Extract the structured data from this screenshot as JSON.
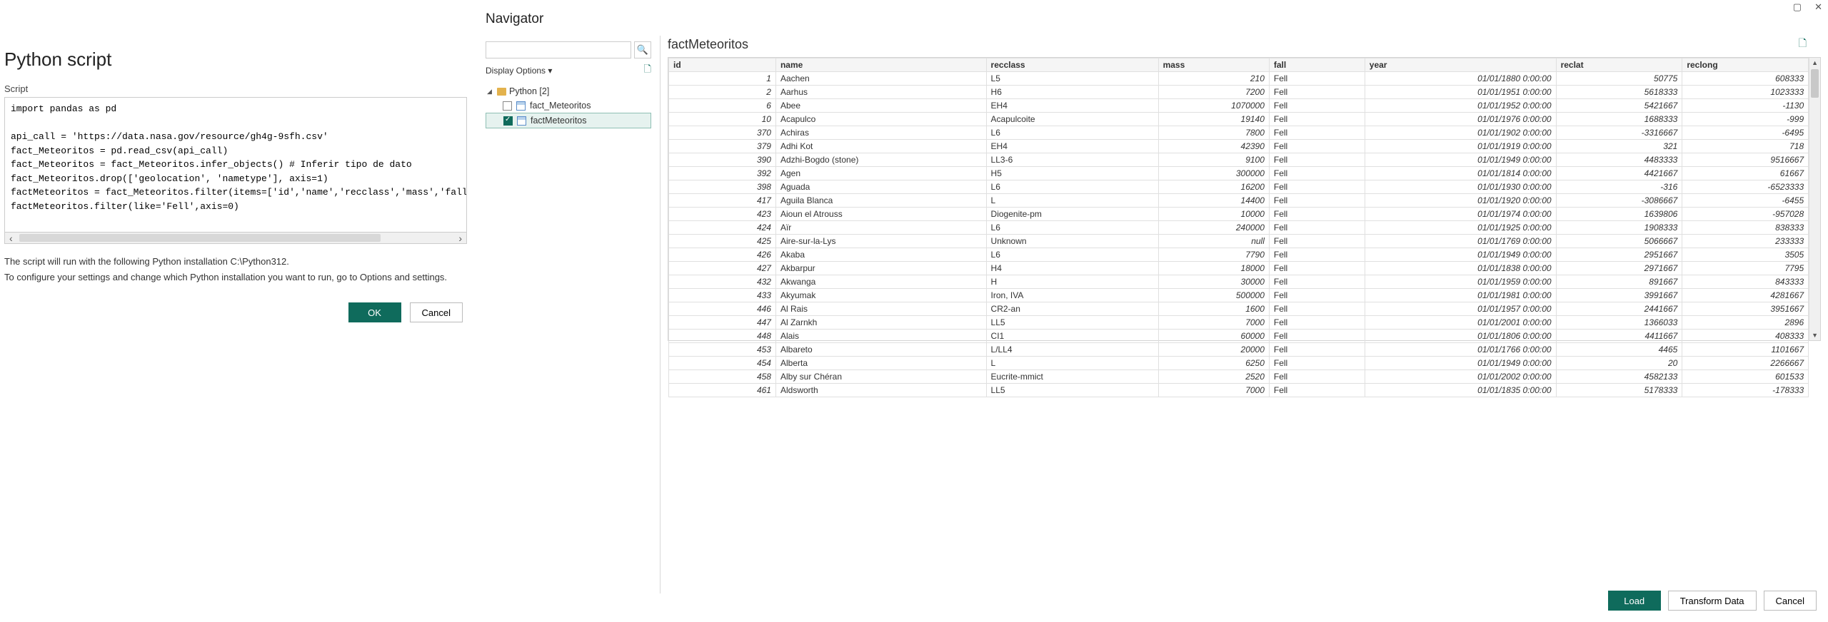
{
  "left": {
    "title": "Python script",
    "script_label": "Script",
    "script_text": "import pandas as pd\n\napi_call = 'https://data.nasa.gov/resource/gh4g-9sfh.csv'\nfact_Meteoritos = pd.read_csv(api_call)\nfact_Meteoritos = fact_Meteoritos.infer_objects() # Inferir tipo de dato\nfact_Meteoritos.drop(['geolocation', 'nametype'], axis=1)\nfactMeteoritos = fact_Meteoritos.filter(items=['id','name','recclass','mass','fall','year','recl\nfactMeteoritos.filter(like='Fell',axis=0)",
    "info1": "The script will run with the following Python installation C:\\Python312.",
    "info2": "To configure your settings and change which Python installation you want to run, go to Options and settings.",
    "ok": "OK",
    "cancel": "Cancel"
  },
  "navigator": {
    "title": "Navigator",
    "display_options": "Display Options",
    "root_label": "Python [2]",
    "items": [
      {
        "label": "fact_Meteoritos",
        "checked": false,
        "selected": false
      },
      {
        "label": "factMeteoritos",
        "checked": true,
        "selected": true
      }
    ]
  },
  "preview": {
    "title": "factMeteoritos",
    "columns": [
      "id",
      "name",
      "recclass",
      "mass",
      "fall",
      "year",
      "reclat",
      "reclong"
    ],
    "rows": [
      {
        "id": 1,
        "name": "Aachen",
        "recclass": "L5",
        "mass": "210",
        "fall": "Fell",
        "year": "01/01/1880 0:00:00",
        "reclat": "50775",
        "reclong": "608333"
      },
      {
        "id": 2,
        "name": "Aarhus",
        "recclass": "H6",
        "mass": "7200",
        "fall": "Fell",
        "year": "01/01/1951 0:00:00",
        "reclat": "5618333",
        "reclong": "1023333"
      },
      {
        "id": 6,
        "name": "Abee",
        "recclass": "EH4",
        "mass": "1070000",
        "fall": "Fell",
        "year": "01/01/1952 0:00:00",
        "reclat": "5421667",
        "reclong": "-1130"
      },
      {
        "id": 10,
        "name": "Acapulco",
        "recclass": "Acapulcoite",
        "mass": "19140",
        "fall": "Fell",
        "year": "01/01/1976 0:00:00",
        "reclat": "1688333",
        "reclong": "-999"
      },
      {
        "id": 370,
        "name": "Achiras",
        "recclass": "L6",
        "mass": "7800",
        "fall": "Fell",
        "year": "01/01/1902 0:00:00",
        "reclat": "-3316667",
        "reclong": "-6495"
      },
      {
        "id": 379,
        "name": "Adhi Kot",
        "recclass": "EH4",
        "mass": "42390",
        "fall": "Fell",
        "year": "01/01/1919 0:00:00",
        "reclat": "321",
        "reclong": "718"
      },
      {
        "id": 390,
        "name": "Adzhi-Bogdo (stone)",
        "recclass": "LL3-6",
        "mass": "9100",
        "fall": "Fell",
        "year": "01/01/1949 0:00:00",
        "reclat": "4483333",
        "reclong": "9516667"
      },
      {
        "id": 392,
        "name": "Agen",
        "recclass": "H5",
        "mass": "300000",
        "fall": "Fell",
        "year": "01/01/1814 0:00:00",
        "reclat": "4421667",
        "reclong": "61667"
      },
      {
        "id": 398,
        "name": "Aguada",
        "recclass": "L6",
        "mass": "16200",
        "fall": "Fell",
        "year": "01/01/1930 0:00:00",
        "reclat": "-316",
        "reclong": "-6523333"
      },
      {
        "id": 417,
        "name": "Aguila Blanca",
        "recclass": "L",
        "mass": "14400",
        "fall": "Fell",
        "year": "01/01/1920 0:00:00",
        "reclat": "-3086667",
        "reclong": "-6455"
      },
      {
        "id": 423,
        "name": "Aioun el Atrouss",
        "recclass": "Diogenite-pm",
        "mass": "10000",
        "fall": "Fell",
        "year": "01/01/1974 0:00:00",
        "reclat": "1639806",
        "reclong": "-957028"
      },
      {
        "id": 424,
        "name": "Aïr",
        "recclass": "L6",
        "mass": "240000",
        "fall": "Fell",
        "year": "01/01/1925 0:00:00",
        "reclat": "1908333",
        "reclong": "838333"
      },
      {
        "id": 425,
        "name": "Aire-sur-la-Lys",
        "recclass": "Unknown",
        "mass": "null",
        "fall": "Fell",
        "year": "01/01/1769 0:00:00",
        "reclat": "5066667",
        "reclong": "233333"
      },
      {
        "id": 426,
        "name": "Akaba",
        "recclass": "L6",
        "mass": "7790",
        "fall": "Fell",
        "year": "01/01/1949 0:00:00",
        "reclat": "2951667",
        "reclong": "3505"
      },
      {
        "id": 427,
        "name": "Akbarpur",
        "recclass": "H4",
        "mass": "18000",
        "fall": "Fell",
        "year": "01/01/1838 0:00:00",
        "reclat": "2971667",
        "reclong": "7795"
      },
      {
        "id": 432,
        "name": "Akwanga",
        "recclass": "H",
        "mass": "30000",
        "fall": "Fell",
        "year": "01/01/1959 0:00:00",
        "reclat": "891667",
        "reclong": "843333"
      },
      {
        "id": 433,
        "name": "Akyumak",
        "recclass": "Iron, IVA",
        "mass": "500000",
        "fall": "Fell",
        "year": "01/01/1981 0:00:00",
        "reclat": "3991667",
        "reclong": "4281667"
      },
      {
        "id": 446,
        "name": "Al Rais",
        "recclass": "CR2-an",
        "mass": "1600",
        "fall": "Fell",
        "year": "01/01/1957 0:00:00",
        "reclat": "2441667",
        "reclong": "3951667"
      },
      {
        "id": 447,
        "name": "Al Zarnkh",
        "recclass": "LL5",
        "mass": "7000",
        "fall": "Fell",
        "year": "01/01/2001 0:00:00",
        "reclat": "1366033",
        "reclong": "2896"
      },
      {
        "id": 448,
        "name": "Alais",
        "recclass": "CI1",
        "mass": "60000",
        "fall": "Fell",
        "year": "01/01/1806 0:00:00",
        "reclat": "4411667",
        "reclong": "408333"
      },
      {
        "id": 453,
        "name": "Albareto",
        "recclass": "L/LL4",
        "mass": "20000",
        "fall": "Fell",
        "year": "01/01/1766 0:00:00",
        "reclat": "4465",
        "reclong": "1101667"
      },
      {
        "id": 454,
        "name": "Alberta",
        "recclass": "L",
        "mass": "6250",
        "fall": "Fell",
        "year": "01/01/1949 0:00:00",
        "reclat": "20",
        "reclong": "2266667"
      },
      {
        "id": 458,
        "name": "Alby sur Chéran",
        "recclass": "Eucrite-mmict",
        "mass": "2520",
        "fall": "Fell",
        "year": "01/01/2002 0:00:00",
        "reclat": "4582133",
        "reclong": "601533"
      },
      {
        "id": 461,
        "name": "Aldsworth",
        "recclass": "LL5",
        "mass": "7000",
        "fall": "Fell",
        "year": "01/01/1835 0:00:00",
        "reclat": "5178333",
        "reclong": "-178333"
      }
    ]
  },
  "footer": {
    "load": "Load",
    "transform": "Transform Data",
    "cancel": "Cancel"
  }
}
